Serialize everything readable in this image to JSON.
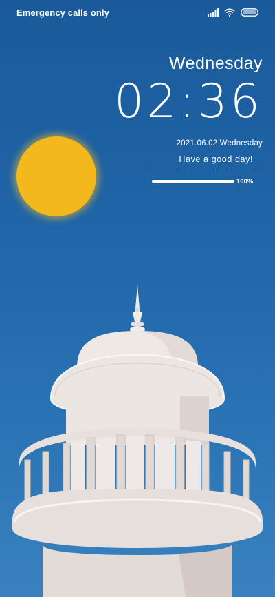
{
  "status_bar": {
    "carrier_text": "Emergency calls only",
    "icons": [
      "signal-icon",
      "wifi-icon",
      "battery-icon"
    ]
  },
  "clock": {
    "weekday": "Wednesday",
    "time": "02:36",
    "date": "2021.06.02",
    "date_weekday": "Wednesday",
    "greeting": "Have a good day!",
    "battery_progress": 1.0,
    "battery_label": "100%"
  },
  "colors": {
    "sky": "#2066a8",
    "sun": "#f3b81c",
    "tower": "#e9e2df"
  }
}
